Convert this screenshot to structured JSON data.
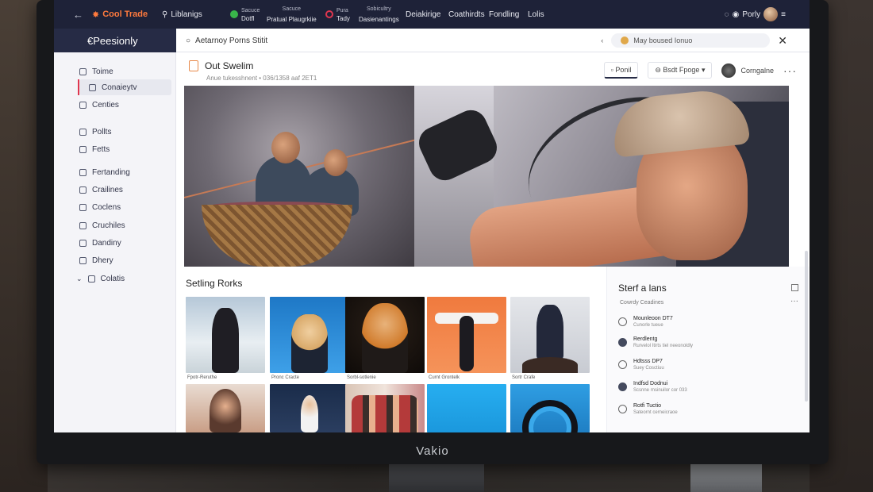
{
  "monitor": {
    "brand": "Vakio"
  },
  "topbar": {
    "back": "←",
    "brand": "Cool Trade",
    "library": "Liblanigs",
    "nav": [
      {
        "top": "Sacuce",
        "bottom": "Dotfl"
      },
      {
        "top": "Sacuce",
        "bottom": "Pratual Plaugrkiie"
      },
      {
        "top": "Pura",
        "bottom": "Tady"
      },
      {
        "top": "Sobicultry",
        "bottom": "Dasienantings"
      },
      {
        "top": "",
        "bottom": "Deiakirige"
      },
      {
        "top": "",
        "bottom": "Coathirdts"
      },
      {
        "top": "",
        "bottom": "Fondling"
      },
      {
        "top": "",
        "bottom": "Lolis"
      }
    ],
    "user": "Porly"
  },
  "subbar": {
    "workspace": "€Peesionly",
    "breadcrumb": "Aetarnoy Porns Stitit",
    "search_value": "May boused Ionuo"
  },
  "sidebar": {
    "items": [
      {
        "label": "Toime"
      },
      {
        "label": "Conaieytv"
      },
      {
        "label": "Centies"
      },
      {
        "label": "Pollts"
      },
      {
        "label": "Fetts"
      },
      {
        "label": "Fertanding"
      },
      {
        "label": "Crailines"
      },
      {
        "label": "Coclens"
      },
      {
        "label": "Cruchiles"
      },
      {
        "label": "Dandiny"
      },
      {
        "label": "Dhery"
      },
      {
        "label": "Colatis"
      }
    ]
  },
  "post": {
    "title": "Out Swelim",
    "meta": "Anue tukesshnent • 036/1358 aaf 2ET1",
    "btn_primary": "Ponil",
    "btn_secondary": "Bsdt Fpoge",
    "user": "Corngalne"
  },
  "gallery": {
    "title": "Setling Rorks",
    "captions": [
      "Fpotr-Reruthe",
      "Pronc Cracte",
      "Sorbl-sotlenie",
      "Curnt Grontelk",
      "Sortr Crafe"
    ]
  },
  "panel": {
    "title": "Sterf a lans",
    "subtitle": "Cowrdy Ceadines",
    "items": [
      {
        "t1": "Mounleoon DT7",
        "t2": "Cunorle tueue"
      },
      {
        "t1": "Rerdlentg",
        "t2": "Rurvelol Itirts tiel neeonoldly"
      },
      {
        "t1": "Hdtsss DP7",
        "t2": "Suey Cosctiuu"
      },
      {
        "t1": "Indfsd Dodnui",
        "t2": "Scsnne rnsinuilor cor 033"
      },
      {
        "t1": "Rotfi Tuctio",
        "t2": "Sateornt cerneicraoe"
      }
    ]
  },
  "colors": {
    "topbar": "#1e2238",
    "accent_orange": "#ff7a3d",
    "accent_red": "#e0364f",
    "accent_green": "#39b54a"
  }
}
